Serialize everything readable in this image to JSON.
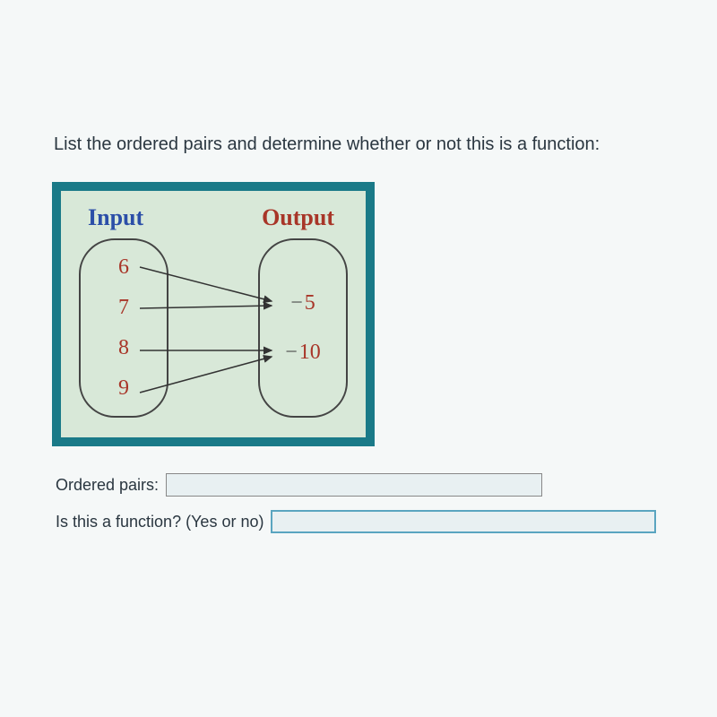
{
  "instruction": "List the ordered pairs and determine whether or not this is a function:",
  "diagram": {
    "input_header": "Input",
    "output_header": "Output",
    "inputs": [
      "6",
      "7",
      "8",
      "9"
    ],
    "outputs": [
      {
        "neg": "−",
        "val": "5"
      },
      {
        "neg": "−",
        "val": "10"
      }
    ],
    "mappings": [
      {
        "from": "6",
        "to": "-5"
      },
      {
        "from": "7",
        "to": "-5"
      },
      {
        "from": "8",
        "to": "-10"
      },
      {
        "from": "9",
        "to": "-10"
      }
    ]
  },
  "form": {
    "ordered_pairs_label": "Ordered pairs:",
    "ordered_pairs_value": "",
    "function_label": "Is this a function? (Yes or no)",
    "function_value": ""
  }
}
